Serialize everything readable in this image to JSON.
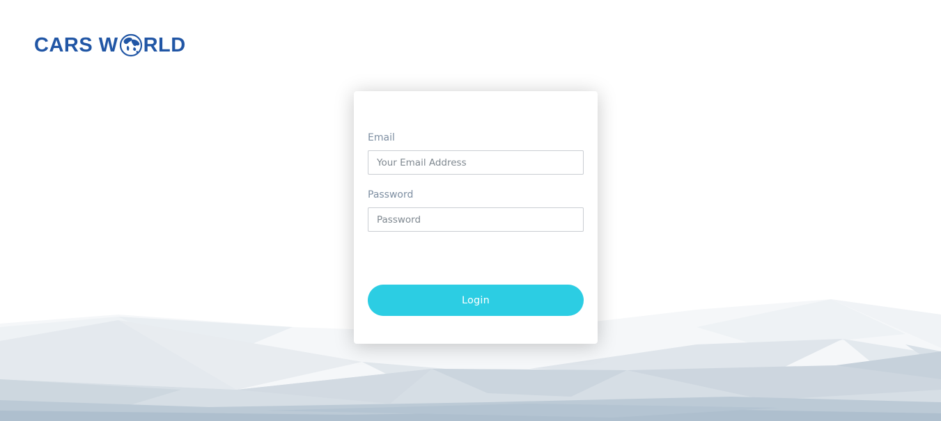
{
  "brand": {
    "name_prefix": "CARS W",
    "name_suffix": "RLD",
    "color": "#2156a5"
  },
  "login_form": {
    "email_label": "Email",
    "email_placeholder": "Your Email Address",
    "email_value": "",
    "password_label": "Password",
    "password_placeholder": "Password",
    "password_value": "",
    "submit_label": "Login",
    "accent": "#2ccde3"
  },
  "icons": {
    "logo_globe": "globe-icon"
  }
}
